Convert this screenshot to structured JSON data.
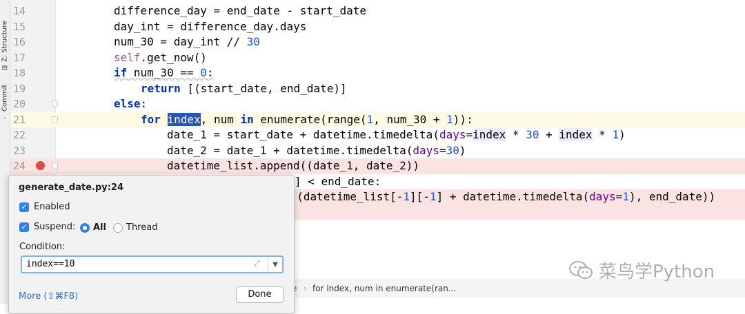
{
  "side_tabs": {
    "structure": "Z: Structure",
    "commit": "Commit"
  },
  "lines": [
    {
      "num": "14"
    },
    {
      "num": "15"
    },
    {
      "num": "16"
    },
    {
      "num": "17"
    },
    {
      "num": "18"
    },
    {
      "num": "19"
    },
    {
      "num": "20"
    },
    {
      "num": "21"
    },
    {
      "num": "22"
    },
    {
      "num": "23"
    },
    {
      "num": "24"
    }
  ],
  "code": {
    "l14": "difference_day = end_date - start_date",
    "l15": "day_int = difference_day.days",
    "l16_a": "num_30 = day_int // ",
    "l16_b": "30",
    "l17_a": "self",
    "l17_b": ".get_now()",
    "l18_kw": "if",
    "l18_a": " num_30 == ",
    "l18_b": "0",
    "l18_c": ":",
    "l19_kw": "return",
    "l19_a": " [(start_date, end_date)]",
    "l20_kw": "else",
    "l20_a": ":",
    "l21_kw1": "for",
    "l21_sp": " ",
    "l21_index": "index",
    "l21_a": ", num ",
    "l21_kw2": "in",
    "l21_b": " enumerate(range(",
    "l21_n1": "1",
    "l21_c": ", num_30 + ",
    "l21_n2": "1",
    "l21_d": ")):",
    "l22_a": "date_1 = start_date + datetime.timedelta(",
    "l22_p": "days",
    "l22_b": "=",
    "l22_i1": "index",
    "l22_c": " * ",
    "l22_n1": "30",
    "l22_d": " + ",
    "l22_i2": "index",
    "l22_e": " * ",
    "l22_n2": "1",
    "l22_f": ")",
    "l23_a": "date_2 = date_1 + datetime.timedelta(",
    "l23_p": "days",
    "l23_b": "=",
    "l23_n": "30",
    "l23_c": ")",
    "l24": "datetime_list.append((date_1, date_2))",
    "l25_tail": "] < end_date:",
    "l26_a": "d((datetime_list[-",
    "l26_n1": "1",
    "l26_b": "][-",
    "l26_n2": "1",
    "l26_c": "] + datetime.timedelta(",
    "l26_p": "days",
    "l26_d": "=",
    "l26_n3": "1",
    "l26_e": "), end_date))"
  },
  "popup": {
    "title": "generate_date.py:24",
    "enabled_label": "Enabled",
    "suspend_label": "Suspend:",
    "all_label": "All",
    "thread_label": "Thread",
    "condition_label": "Condition:",
    "condition_value": "index==10",
    "more_label": "More (⇧⌘F8)",
    "done_label": "Done",
    "check_mark": "✓"
  },
  "breadcrumb": {
    "fragment": "e",
    "separator": "›",
    "item": "for index, num in enumerate(ran..."
  },
  "watermark": {
    "text": "菜鸟学Python"
  },
  "colors": {
    "keyword": "#0033b3",
    "number": "#1750eb",
    "breakpoint": "#dd4a4a",
    "selection": "#2a55b3",
    "accent": "#2f83e8"
  }
}
